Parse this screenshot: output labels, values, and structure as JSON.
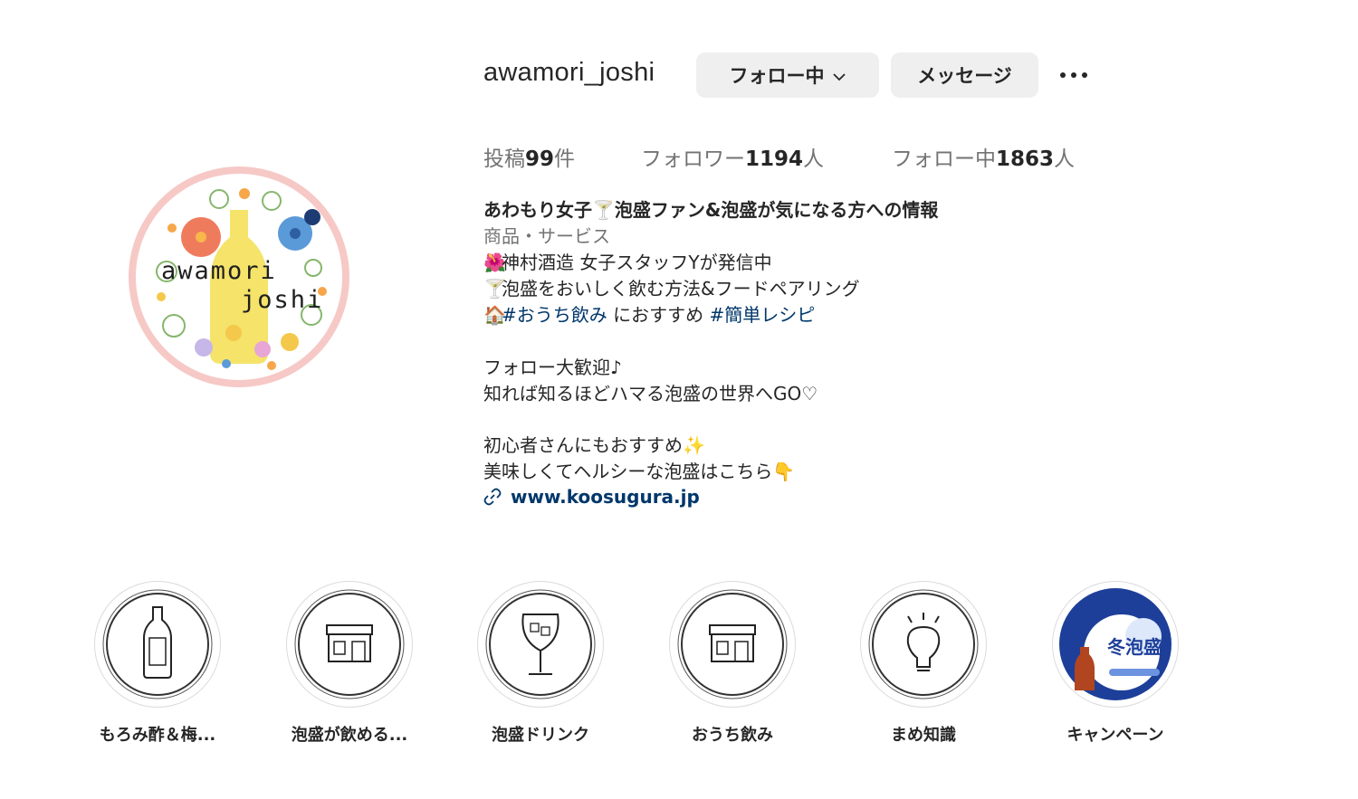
{
  "profile": {
    "username": "awamori_joshi",
    "avatar_text_line1": "awamori",
    "avatar_text_line2": "joshi",
    "follow_button": "フォロー中",
    "message_button": "メッセージ",
    "more_icon": "more-horizontal-icon"
  },
  "stats": {
    "posts_label": "投稿",
    "posts_count": "99",
    "posts_unit": "件",
    "followers_label": "フォロワー",
    "followers_count": "1194",
    "followers_unit": "人",
    "following_label": "フォロー中",
    "following_count": "1863",
    "following_unit": "人"
  },
  "bio": {
    "name": "あわもり女子🍸泡盛ファン&泡盛が気になる方への情報",
    "category": "商品・サービス",
    "line1": "神村酒造 女子スタッフYが発信中",
    "line2": "泡盛をおいしく飲む方法&フードペアリング",
    "line3_tag1": "#おうち飲み",
    "line3_mid": " におすすめ ",
    "line3_tag2": "#簡単レシピ",
    "line4": "フォロー大歓迎♪",
    "line5": "知れば知るほどハマる泡盛の世界へGO♡",
    "line6": "初心者さんにもおすすめ✨",
    "line7": "美味しくてヘルシーな泡盛はこちら👇",
    "link": "www.koosugura.jp",
    "emoji1": "🌺",
    "emoji2": "🍸",
    "emoji3": "🏠"
  },
  "highlights": [
    {
      "label": "もろみ酢＆梅...",
      "icon": "bottle-icon"
    },
    {
      "label": "泡盛が飲める...",
      "icon": "store-icon"
    },
    {
      "label": "泡盛ドリンク",
      "icon": "glass-icon"
    },
    {
      "label": "おうち飲み",
      "icon": "store-icon"
    },
    {
      "label": "まめ知識",
      "icon": "lightbulb-icon"
    },
    {
      "label": "キャンペーン",
      "icon": "campaign-image",
      "image_text": "冬泡盛"
    }
  ],
  "colors": {
    "text": "#262626",
    "muted": "#737373",
    "link": "#00376b",
    "button_bg": "#efefef",
    "avatar_ring": "#f6c9c6"
  }
}
